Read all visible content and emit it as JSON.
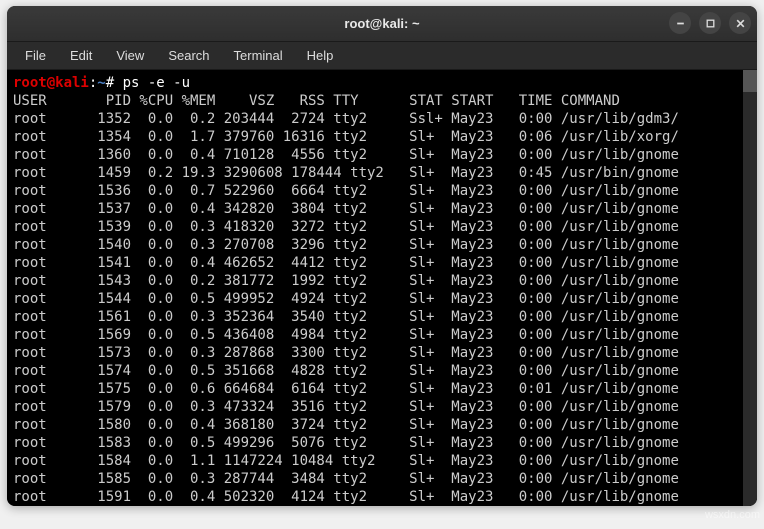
{
  "window": {
    "title": "root@kali: ~"
  },
  "menubar": [
    "File",
    "Edit",
    "View",
    "Search",
    "Terminal",
    "Help"
  ],
  "prompt": {
    "user_host": "root@kali",
    "sep1": ":",
    "path": "~",
    "sep2": "# ",
    "command": "ps -e -u"
  },
  "header": "USER       PID %CPU %MEM    VSZ   RSS TTY      STAT START   TIME COMMAND",
  "rows": [
    "root      1352  0.0  0.2 203444  2724 tty2     Ssl+ May23   0:00 /usr/lib/gdm3/",
    "root      1354  0.0  1.7 379760 16316 tty2     Sl+  May23   0:06 /usr/lib/xorg/",
    "root      1360  0.0  0.4 710128  4556 tty2     Sl+  May23   0:00 /usr/lib/gnome",
    "root      1459  0.2 19.3 3290608 178444 tty2   Sl+  May23   0:45 /usr/bin/gnome",
    "root      1536  0.0  0.7 522960  6664 tty2     Sl+  May23   0:00 /usr/lib/gnome",
    "root      1537  0.0  0.4 342820  3804 tty2     Sl+  May23   0:00 /usr/lib/gnome",
    "root      1539  0.0  0.3 418320  3272 tty2     Sl+  May23   0:00 /usr/lib/gnome",
    "root      1540  0.0  0.3 270708  3296 tty2     Sl+  May23   0:00 /usr/lib/gnome",
    "root      1541  0.0  0.4 462652  4412 tty2     Sl+  May23   0:00 /usr/lib/gnome",
    "root      1543  0.0  0.2 381772  1992 tty2     Sl+  May23   0:00 /usr/lib/gnome",
    "root      1544  0.0  0.5 499952  4924 tty2     Sl+  May23   0:00 /usr/lib/gnome",
    "root      1561  0.0  0.3 352364  3540 tty2     Sl+  May23   0:00 /usr/lib/gnome",
    "root      1569  0.0  0.5 436408  4984 tty2     Sl+  May23   0:00 /usr/lib/gnome",
    "root      1573  0.0  0.3 287868  3300 tty2     Sl+  May23   0:00 /usr/lib/gnome",
    "root      1574  0.0  0.5 351668  4828 tty2     Sl+  May23   0:00 /usr/lib/gnome",
    "root      1575  0.0  0.6 664684  6164 tty2     Sl+  May23   0:01 /usr/lib/gnome",
    "root      1579  0.0  0.3 473324  3516 tty2     Sl+  May23   0:00 /usr/lib/gnome",
    "root      1580  0.0  0.4 368180  3724 tty2     Sl+  May23   0:00 /usr/lib/gnome",
    "root      1583  0.0  0.5 499296  5076 tty2     Sl+  May23   0:00 /usr/lib/gnome",
    "root      1584  0.0  1.1 1147224 10484 tty2    Sl+  May23   0:00 /usr/lib/gnome",
    "root      1585  0.0  0.3 287744  3484 tty2     Sl+  May23   0:00 /usr/lib/gnome",
    "root      1591  0.0  0.4 502320  4124 tty2     Sl+  May23   0:00 /usr/lib/gnome"
  ],
  "watermark": "wsxdn.com"
}
